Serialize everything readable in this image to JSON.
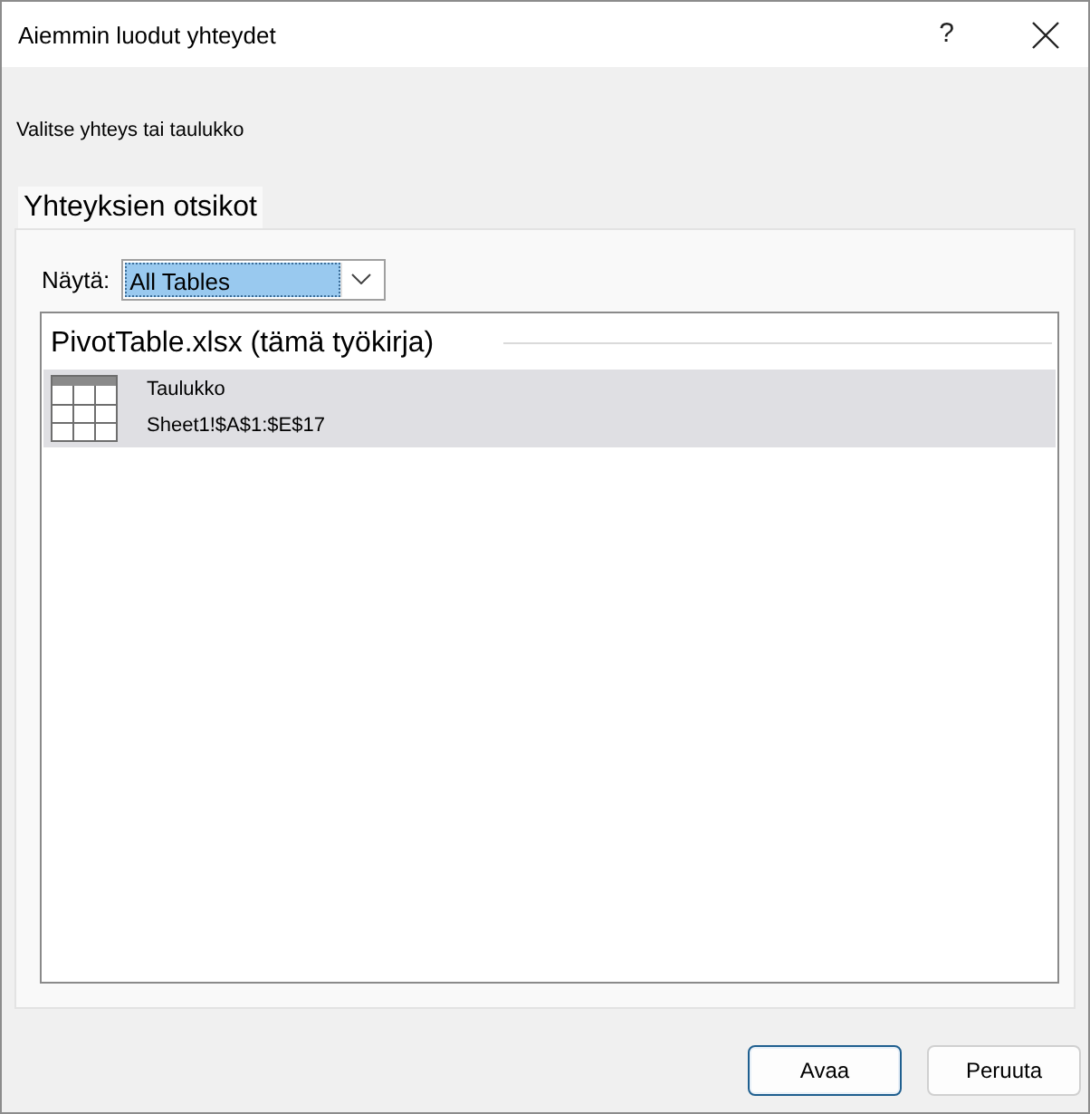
{
  "window": {
    "title": "Aiemmin luodut yhteydet",
    "help": "?"
  },
  "instruction": "Valitse yhteys tai taulukko",
  "tabs": [
    {
      "label": "Yhteyksien otsikot",
      "selected": true
    }
  ],
  "filter": {
    "label": "Näytä:",
    "value": "All Tables",
    "focused": true
  },
  "groups": [
    {
      "title": "PivotTable.xlsx (tämä työkirja)",
      "items": [
        {
          "name": "Taulukko",
          "range": "Sheet1!$A$1:$E$17",
          "selected": true
        }
      ]
    }
  ],
  "buttons": [
    {
      "label": "Avaa",
      "default": true
    },
    {
      "label": "Peruuta",
      "default": false
    }
  ]
}
